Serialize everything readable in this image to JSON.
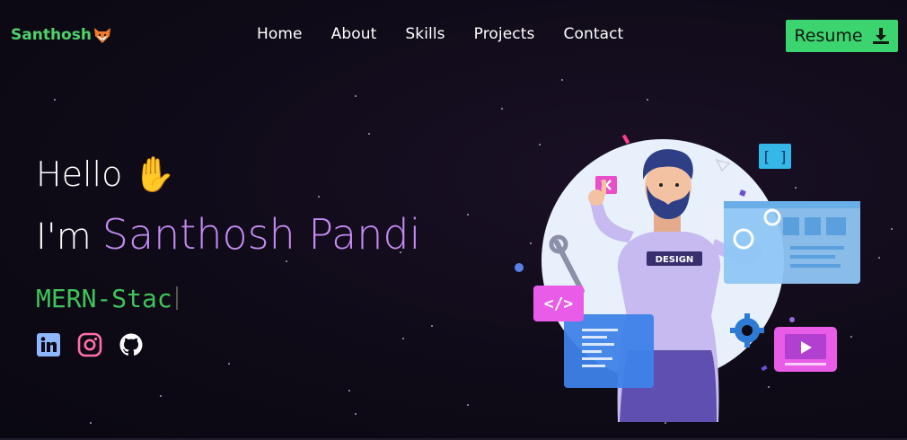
{
  "brand": {
    "name": "Santhosh",
    "icon": "fox-icon"
  },
  "nav": {
    "items": [
      {
        "label": "Home"
      },
      {
        "label": "About"
      },
      {
        "label": "Skills"
      },
      {
        "label": "Projects"
      },
      {
        "label": "Contact"
      }
    ]
  },
  "resume": {
    "label": "Resume",
    "icon": "download-icon"
  },
  "hero": {
    "greeting": "Hello",
    "wave": "✋",
    "prefix": "I'm",
    "name": "Santhosh Pandi",
    "typed_text": "MERN-Stac"
  },
  "social": [
    {
      "icon": "linkedin-icon",
      "color": "#8fb7ff"
    },
    {
      "icon": "instagram-icon",
      "color": "#ff6fa8"
    },
    {
      "icon": "github-icon",
      "color": "#ffffff"
    }
  ],
  "illustration": {
    "badge_text": "DESIGN",
    "icon": "developer-illustration"
  },
  "colors": {
    "accent_green": "#3cd46f",
    "name_purple": "#c58af5",
    "background": "#0e0a16"
  }
}
